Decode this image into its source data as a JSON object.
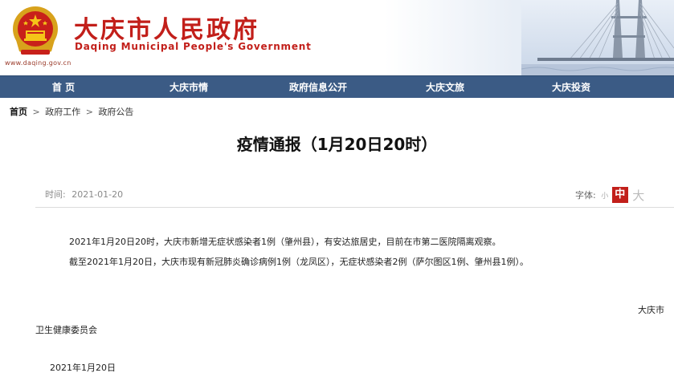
{
  "header": {
    "site_url": "www.daqing.gov.cn",
    "title_cn": "大庆市人民政府",
    "title_en": "Daqing Municipal People's Government"
  },
  "nav": {
    "items": [
      {
        "label": "首 页"
      },
      {
        "label": "大庆市情"
      },
      {
        "label": "政府信息公开"
      },
      {
        "label": "大庆文旅"
      },
      {
        "label": "大庆投资"
      }
    ]
  },
  "breadcrumb": {
    "home": "首页",
    "sep": ">",
    "level1": "政府工作",
    "level2": "政府公告"
  },
  "article": {
    "title": "疫情通报（1月20日20时）",
    "time_label": "时间:",
    "time_value": "2021-01-20",
    "font_label": "字体:",
    "font_small": "小",
    "font_mid": "中",
    "font_large": "大",
    "para1": "2021年1月20日20时，大庆市新增无症状感染者1例（肇州县），有安达旅居史，目前在市第二医院隔离观察。",
    "para2": "截至2021年1月20日，大庆市现有新冠肺炎确诊病例1例（龙凤区），无症状感染者2例（萨尔图区1例、肇州县1例）。",
    "sign_part1": "大庆市",
    "sign_part2": "卫生健康委员会",
    "sign_date": "2021年1月20日"
  },
  "colors": {
    "brand_red": "#c21f1a",
    "nav_blue": "#3b5b85"
  }
}
